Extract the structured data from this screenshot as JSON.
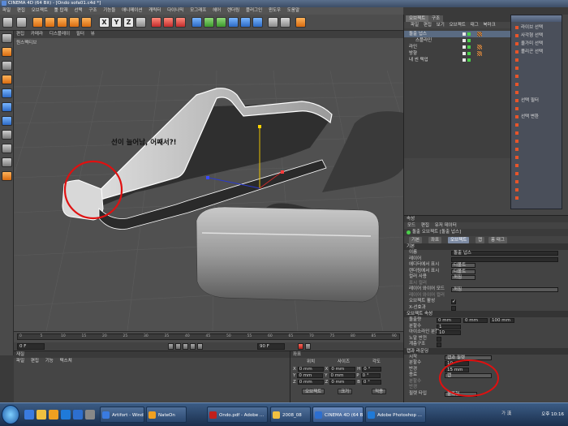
{
  "window": {
    "title": "CINEMA 4D (64 Bit) - [Ondo sofa01.c4d *]"
  },
  "menubar": [
    "파일",
    "편집",
    "오브젝트",
    "툴 탑재",
    "선택",
    "구조",
    "기능들",
    "애니메이션",
    "캐릭터",
    "다이나믹",
    "모그래프",
    "헤어",
    "렌더링",
    "플러그인",
    "윈도우",
    "도움말"
  ],
  "viewport": {
    "menu": [
      "편집",
      "카메라",
      "디스플레이",
      "필터",
      "뷰"
    ],
    "label": "원스펙티브",
    "annotation": "선이 늘어남, 어째서?!"
  },
  "timeline": {
    "frame_start": "0 F",
    "frame_end": "90 F",
    "ticks": [
      "0",
      "5",
      "10",
      "15",
      "20",
      "25",
      "30",
      "35",
      "40",
      "45",
      "50",
      "55",
      "60",
      "65",
      "70",
      "75",
      "80",
      "85",
      "90"
    ]
  },
  "materials": {
    "title": "재질",
    "menu": [
      "파일",
      "편집",
      "기능",
      "텍스쳐"
    ]
  },
  "coordinates": {
    "title": "좌표",
    "cols": [
      "위치",
      "사이즈",
      "각도"
    ],
    "rows": [
      {
        "axis": "X",
        "pos": "0 mm",
        "size": "0 mm",
        "angle_label": "H",
        "angle": "0 °"
      },
      {
        "axis": "Y",
        "pos": "0 mm",
        "size": "0 mm",
        "angle_label": "P",
        "angle": "0 °"
      },
      {
        "axis": "Z",
        "pos": "0 mm",
        "size": "0 mm",
        "angle_label": "B",
        "angle": "0 °"
      }
    ],
    "mode_dropdown": "오브젝트",
    "size_dropdown": "크기",
    "apply_button": "적용"
  },
  "object_manager": {
    "tabs": [
      "오브젝트",
      "구조"
    ],
    "menu": [
      "파일",
      "편집",
      "보기",
      "오브젝트",
      "태그",
      "북마크"
    ],
    "items": [
      {
        "name": "돌출 넙스",
        "selected": true
      },
      {
        "name": "스플라인",
        "selected": false
      },
      {
        "name": "라인",
        "selected": false
      },
      {
        "name": "방향",
        "selected": false
      },
      {
        "name": "내 씬 택업",
        "selected": false
      }
    ]
  },
  "palette": {
    "items": [
      "라이브 선택",
      "사각형 선택",
      "올가미 선택",
      "폴리곤 선택",
      "",
      "",
      "",
      "",
      "",
      "선택 필터",
      "",
      "선택 변환",
      "",
      "",
      "",
      "",
      "",
      "",
      "",
      "",
      "",
      ""
    ]
  },
  "attributes": {
    "title": "속성",
    "menu": [
      "모드",
      "편집",
      "유저 데이터"
    ],
    "header": "돌출 오브젝트 [돌출 넙스]",
    "tabs": [
      "기본",
      "좌표",
      "오브젝트",
      "캡",
      "퐁 태그"
    ],
    "section_basic": "기본",
    "basic_rows": [
      {
        "label": "이름",
        "value": "돌출 넙스"
      },
      {
        "label": "레이어",
        "value": ""
      },
      {
        "label": "에디터에서 표시",
        "value": "디폴트"
      },
      {
        "label": "렌더링에서 표시",
        "value": "디폴트"
      },
      {
        "label": "컬러 사용",
        "value": "꺼짐"
      },
      {
        "label": "표시 컬러",
        "value": ""
      },
      {
        "label": "레이어 와이어 모드",
        "value": "꺼짐"
      },
      {
        "label": "레이어 와이어 컬러",
        "value": ""
      },
      {
        "label": "오브젝트 활성",
        "value": ""
      },
      {
        "label": "X-선효과",
        "value": ""
      }
    ],
    "section_object": "오브젝트 속성",
    "object_rows": [
      {
        "label": "돌출량",
        "v1": "0 mm",
        "v2": "0 mm",
        "v3": "100 mm"
      },
      {
        "label": "분할수",
        "value": "1"
      },
      {
        "label": "아이소라인 분할",
        "value": "10"
      },
      {
        "label": "노말 반전",
        "value": ""
      },
      {
        "label": "계층구조",
        "value": ""
      }
    ],
    "section_caps": "캡과 라운딩",
    "cap_rows": [
      {
        "label": "시작",
        "value": "캡과 필렛"
      },
      {
        "label": "분할수",
        "value": "10"
      },
      {
        "label": "반경",
        "value": "15 mm"
      },
      {
        "label": "종료",
        "value": "캡"
      },
      {
        "label": "분할수",
        "value": ""
      },
      {
        "label": "반경",
        "value": ""
      },
      {
        "label": "필렛 타입",
        "value": "볼록형"
      }
    ]
  },
  "taskbar": {
    "tasks": [
      {
        "label": "Artifort - Windows...",
        "color": "#3a7be0"
      },
      {
        "label": "NateOn",
        "color": "#f0a020"
      },
      {
        "label": "Ondo.pdf - Adobe ...",
        "color": "#c0201c"
      },
      {
        "label": "2008_08",
        "color": "#f0c040"
      },
      {
        "label": "CINEMA 4D (64 Bi...",
        "color": "#2d6fd0"
      },
      {
        "label": "Adobe Photoshop ...",
        "color": "#1f7ad8"
      }
    ],
    "clock": "오후 10:16",
    "lang": "가 漢"
  }
}
